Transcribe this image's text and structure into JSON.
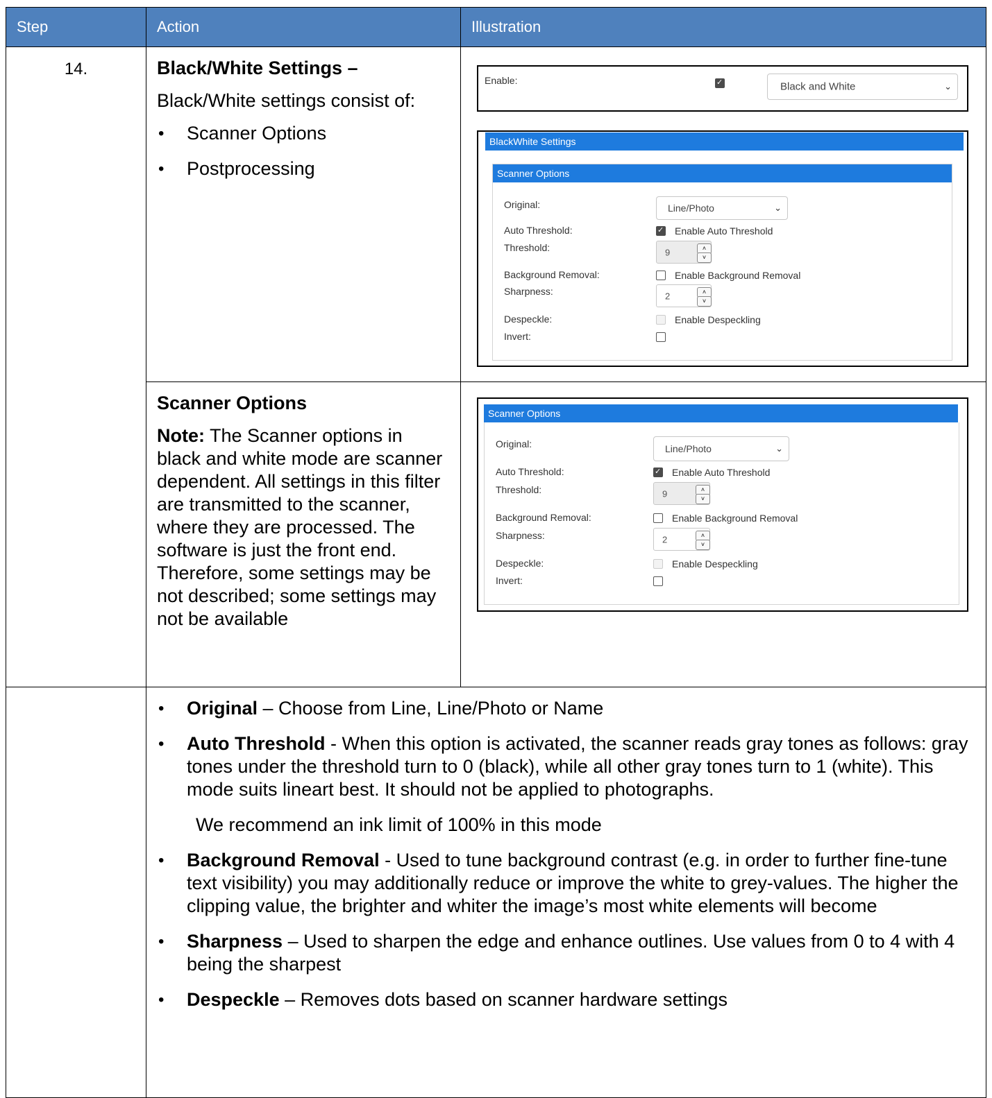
{
  "header": {
    "step": "Step",
    "action": "Action",
    "illustration": "Illustration"
  },
  "row1": {
    "step": "14.",
    "title": "Black/White Settings –",
    "intro": "Black/White settings consist of:",
    "bullets": [
      "Scanner Options",
      "Postprocessing"
    ]
  },
  "row2": {
    "title": "Scanner Options",
    "note_label": "Note:",
    "note_text": " The Scanner options in black and white mode are scanner dependent. All settings in this filter are transmitted to the scanner, where they are processed. The software is just the front end. Therefore, some settings may be not described; some settings may not be available"
  },
  "enable_box": {
    "label": "Enable:",
    "checked": true,
    "mode_value": "Black and White"
  },
  "bw_settings": {
    "title": "BlackWhite Settings",
    "scanner_title": "Scanner Options"
  },
  "scanner_options": {
    "original_label": "Original:",
    "original_value": "Line/Photo",
    "auto_threshold_label": "Auto Threshold:",
    "auto_threshold_text": "Enable Auto Threshold",
    "threshold_label": "Threshold:",
    "threshold_value": "9",
    "background_label": "Background Removal:",
    "background_text": "Enable Background Removal",
    "sharpness_label": "Sharpness:",
    "sharpness_value": "2",
    "despeckle_label": "Despeckle:",
    "despeckle_text": "Enable Despeckling",
    "invert_label": "Invert:",
    "arrow_up": "˄",
    "arrow_down": "˅",
    "select_arrow": "⌄"
  },
  "descriptions": [
    {
      "term": "Original",
      "text": " – Choose from Line, Line/Photo or Name"
    },
    {
      "term": "Auto Threshold",
      "text": " - When this option is activated, the scanner reads gray tones as follows: gray tones under the threshold turn to 0 (black), while all other gray tones turn to 1 (white). This mode suits lineart best. It should not be applied to photographs."
    },
    {
      "term": "Background Removal",
      "text": " - Used to tune background contrast (e.g. in order to further fine-tune text visibility) you may additionally reduce or improve the white to grey-values. The higher the clipping value, the brighter and whiter the image’s most white elements will become"
    },
    {
      "term": "Sharpness",
      "text": " – Used to sharpen the edge and enhance outlines. Use values from 0 to 4 with 4 being the sharpest"
    },
    {
      "term": "Despeckle",
      "text": " – Removes dots based on scanner hardware settings"
    }
  ],
  "recommend_text": "We recommend an ink limit of 100% in this mode",
  "colors": {
    "header_bg": "#4f81bd",
    "ui_blue": "#1e7bde"
  }
}
